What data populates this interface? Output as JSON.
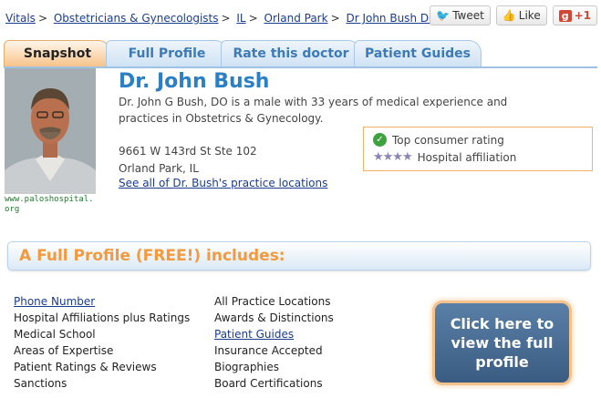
{
  "breadcrumb": [
    "Vitals",
    "Obstetricians & Gynecologists",
    "IL",
    "Orland Park",
    "Dr John Bush DO"
  ],
  "social": {
    "tweet": "Tweet",
    "like": "Like",
    "gplus": "+1"
  },
  "tabs": [
    "Snapshot",
    "Full Profile",
    "Rate this doctor",
    "Patient Guides"
  ],
  "doctor": {
    "name": "Dr. John Bush",
    "description": "Dr. John G Bush, DO is a male with 33 years of medical experience and practices in Obstetrics & Gynecology.",
    "address_line1": "9661 W 143rd St Ste 102",
    "address_line2": "Orland Park, IL",
    "locations_link": "See all of Dr. Bush's practice locations",
    "photo_caption": "www.paloshospital.org"
  },
  "badges": {
    "top_rating": "Top consumer rating",
    "hospital": "Hospital affiliation"
  },
  "banner": "A Full Profile (FREE!) includes:",
  "features_left": [
    "Phone Number",
    "Hospital Affiliations plus Ratings",
    "Medical School",
    "Areas of Expertise",
    "Patient Ratings & Reviews",
    "Sanctions"
  ],
  "features_right": [
    "All Practice Locations",
    "Awards & Distinctions",
    "Patient Guides",
    "Insurance Accepted",
    "Biographies",
    "Board Certifications"
  ],
  "cta": "Click here to view the full profile",
  "icons": {
    "tweet": "twitter-bird-icon",
    "like": "thumbs-up-icon",
    "check": "checkmark-icon",
    "stars": "star-rating-icon"
  },
  "colors": {
    "accent": "#2b7fc4",
    "orange": "#f39a3c",
    "link": "#1a3c8f"
  }
}
